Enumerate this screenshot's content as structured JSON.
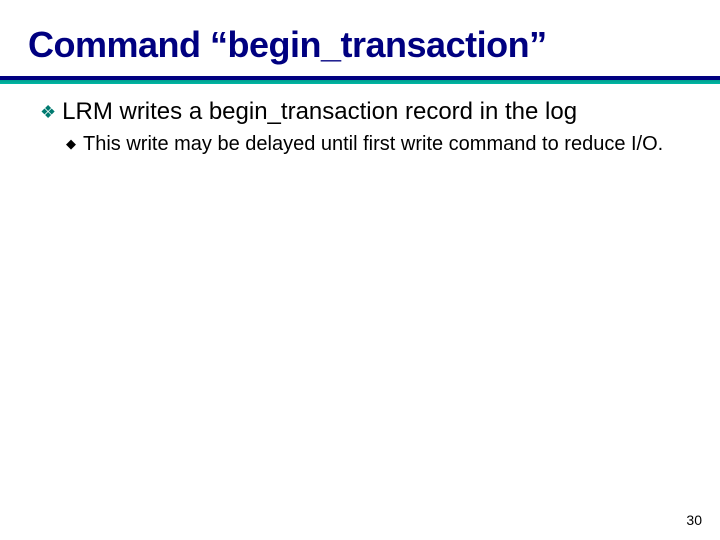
{
  "slide": {
    "title": "Command “begin_transaction”",
    "points": {
      "p1": "LRM writes a begin_transaction record in the log",
      "p1_sub1": "This write may be delayed until first write command to reduce I/O."
    },
    "page_number": "30"
  }
}
